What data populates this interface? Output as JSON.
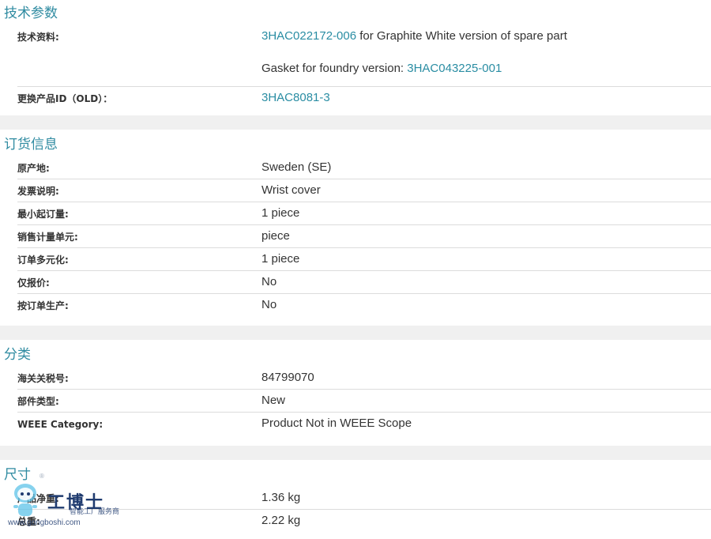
{
  "tech": {
    "title": "技术参数",
    "rows": [
      {
        "label": "技术资料:",
        "link1": "3HAC022172-006",
        "text1": " for Graphite White version of spare part",
        "text2": "Gasket for foundry version: ",
        "link2": "3HAC043225-001"
      },
      {
        "label": "更换产品ID（OLD）：",
        "link": "3HAC8081-3"
      }
    ]
  },
  "order": {
    "title": "订货信息",
    "rows": [
      {
        "label": "原产地:",
        "value": "Sweden (SE)"
      },
      {
        "label": "发票说明:",
        "value": "Wrist cover"
      },
      {
        "label": "最小起订量:",
        "value": "1 piece"
      },
      {
        "label": "销售计量单元:",
        "value": "piece"
      },
      {
        "label": "订单多元化:",
        "value": "1 piece"
      },
      {
        "label": "仅报价:",
        "value": "No"
      },
      {
        "label": "按订单生产:",
        "value": "No"
      }
    ]
  },
  "classification": {
    "title": "分类",
    "rows": [
      {
        "label": "海关关税号:",
        "value": "84799070"
      },
      {
        "label": "部件类型:",
        "value": "New"
      },
      {
        "label": "WEEE Category:",
        "value": "Product Not in WEEE Scope"
      }
    ]
  },
  "dimensions": {
    "title": "尺寸",
    "rows": [
      {
        "label": "产品净重:",
        "value": "1.36 kg"
      },
      {
        "label": "总重:",
        "value": "2.22 kg"
      }
    ]
  },
  "watermark": {
    "brand": "工博士",
    "subtitle": "智能工厂服务商",
    "url": "www.gongboshi.com",
    "reg": "®"
  }
}
